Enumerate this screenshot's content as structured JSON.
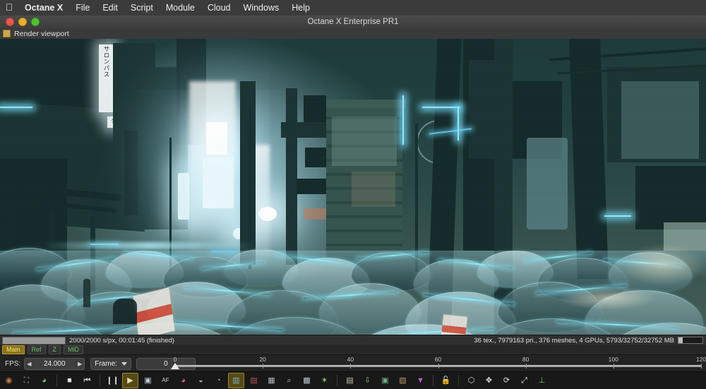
{
  "menubar": {
    "apple_icon": "apple-logo-icon",
    "items": [
      {
        "label": "Octane X",
        "bold": true
      },
      {
        "label": "File"
      },
      {
        "label": "Edit"
      },
      {
        "label": "Script"
      },
      {
        "label": "Module"
      },
      {
        "label": "Cloud"
      },
      {
        "label": "Windows"
      },
      {
        "label": "Help"
      }
    ]
  },
  "window": {
    "title": "Octane X Enterprise PR1",
    "controls": [
      "close",
      "minimize",
      "zoom"
    ]
  },
  "panel": {
    "tab_label": "Render viewport",
    "tab_swatch_color": "#c8a84b"
  },
  "render": {
    "scene_description": "Cyberpunk Japanese street at night with glowing billboards, torii gate and crowd of translucent umbrellas",
    "sign_text_vertical": "サロンパス",
    "sign_text_small": "クロバに"
  },
  "status": {
    "progress_percent": 100,
    "samples_text": "2000/2000 s/px, 00:01:45 (finished)",
    "scene_stats": "36 tex., 7979163 pri., 376 meshes, 4 GPUs, 5793/32752/32752 MB",
    "memory_fill_percent": 18
  },
  "passes": {
    "buttons": [
      {
        "label": "Main",
        "active": true
      },
      {
        "label": "Ref",
        "active": false
      },
      {
        "label": "Z",
        "active": false
      },
      {
        "label": "MiD",
        "active": false
      }
    ],
    "active_color": "#ffe36a",
    "inactive_color": "#62c466"
  },
  "transport": {
    "fps_label": "FPS:",
    "fps_value": "24.000",
    "fps_prev_icon": "triangle-left-icon",
    "fps_next_icon": "triangle-right-icon",
    "frame_label": "Frame:",
    "frame_dropdown_icon": "chevron-down-icon",
    "frame_value": "0"
  },
  "timeline": {
    "ticks": [
      0,
      20,
      40,
      60,
      80,
      100,
      120
    ],
    "min": 0,
    "max": 120,
    "playhead": 0,
    "playhead_icon": "playhead-marker-icon"
  },
  "toolbar": {
    "buttons": [
      {
        "name": "render-target-icon",
        "glyph": "◉",
        "color": "#c9794a",
        "active": false
      },
      {
        "name": "node-graph-icon",
        "glyph": "⛶",
        "color": "#9aa5ad",
        "active": false
      },
      {
        "name": "color-sphere-icon",
        "glyph": "◕",
        "color": "#5fd06a",
        "active": false
      },
      {
        "name": "separator-1",
        "glyph": "",
        "color": "",
        "active": false
      },
      {
        "name": "stop-button",
        "glyph": "■",
        "color": "#dcdcdc",
        "active": false
      },
      {
        "name": "rewind-to-start-button",
        "glyph": "⏮",
        "color": "#dcdcdc",
        "active": false
      },
      {
        "name": "separator-2",
        "glyph": "",
        "color": "",
        "active": false
      },
      {
        "name": "pause-button",
        "glyph": "❙❙",
        "color": "#dcdcdc",
        "active": false
      },
      {
        "name": "play-button",
        "glyph": "▶",
        "color": "#e7dca8",
        "active": true
      },
      {
        "name": "display-monitor-icon",
        "glyph": "▣",
        "color": "#bcc9d2",
        "active": false
      },
      {
        "name": "anti-aliasing-icon",
        "glyph": "AF",
        "color": "#d8d8d8",
        "active": false
      },
      {
        "name": "color-wheel-icon",
        "glyph": "◕",
        "color": "#d85b7a",
        "active": false
      },
      {
        "name": "imager-icon",
        "glyph": "◒",
        "color": "#9fb4bd",
        "active": false
      },
      {
        "name": "post-processing-icon",
        "glyph": "◔",
        "color": "#c2a05e",
        "active": false
      },
      {
        "name": "camera-imager-icon",
        "glyph": "▥",
        "color": "#7fb2c8",
        "active": true
      },
      {
        "name": "region-render-icon",
        "glyph": "▤",
        "color": "#c05454",
        "active": false
      },
      {
        "name": "crop-region-icon",
        "glyph": "▦",
        "color": "#a9b6bd",
        "active": false
      },
      {
        "name": "pick-material-icon",
        "glyph": "⌕",
        "color": "#9fc4d4",
        "active": false
      },
      {
        "name": "alpha-checker-icon",
        "glyph": "▩",
        "color": "#b8c4ca",
        "active": false
      },
      {
        "name": "focus-picker-icon",
        "glyph": "✶",
        "color": "#86cf6b",
        "active": false
      },
      {
        "name": "separator-3",
        "glyph": "",
        "color": "",
        "active": false
      },
      {
        "name": "save-image-icon",
        "glyph": "▤",
        "color": "#c8c1a8",
        "active": false
      },
      {
        "name": "export-render-icon",
        "glyph": "⇩",
        "color": "#7fbf63",
        "active": false
      },
      {
        "name": "lock-resolution-icon",
        "glyph": "▣",
        "color": "#6fae86",
        "active": false
      },
      {
        "name": "texture-preview-icon",
        "glyph": "▨",
        "color": "#b79a66",
        "active": false
      },
      {
        "name": "filter-cone-icon",
        "glyph": "▼",
        "color": "#b45fd4",
        "active": false
      },
      {
        "name": "separator-4",
        "glyph": "",
        "color": "",
        "active": false
      },
      {
        "name": "unlock-icon",
        "glyph": "🔓",
        "color": "#c9c9c9",
        "active": false
      },
      {
        "name": "separator-5",
        "glyph": "",
        "color": "",
        "active": false
      },
      {
        "name": "bounding-box-icon",
        "glyph": "⬡",
        "color": "#d4d4d4",
        "active": false
      },
      {
        "name": "move-tool-icon",
        "glyph": "✥",
        "color": "#e0e0e0",
        "active": false
      },
      {
        "name": "rotate-tool-icon",
        "glyph": "⟳",
        "color": "#e0e0e0",
        "active": false
      },
      {
        "name": "scale-tool-icon",
        "glyph": "⤢",
        "color": "#e0e0e0",
        "active": false
      },
      {
        "name": "axis-gizmo-icon",
        "glyph": "⊥",
        "color": "#7ecf4f",
        "active": false
      }
    ]
  }
}
